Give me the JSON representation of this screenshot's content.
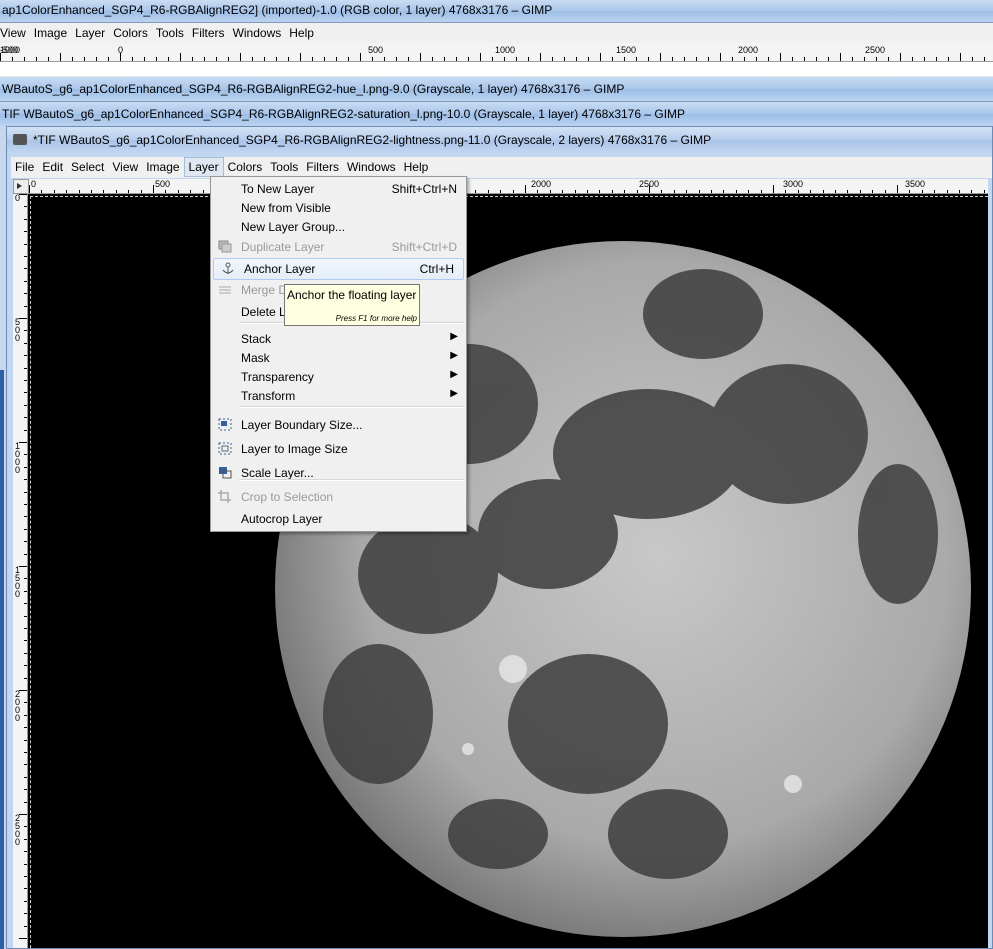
{
  "background_window": {
    "title": "ap1ColorEnhanced_SGP4_R6-RGBAlignREG2] (imported)-1.0 (RGB color, 1 layer) 4768x3176 – GIMP",
    "menu": [
      "View",
      "Image",
      "Layer",
      "Colors",
      "Tools",
      "Filters",
      "Windows",
      "Help"
    ],
    "ruler_ticks": [
      "1000",
      "-500",
      "0",
      "500",
      "1000",
      "1500",
      "2000",
      "2500"
    ]
  },
  "window_hue": {
    "title": "WBautoS_g6_ap1ColorEnhanced_SGP4_R6-RGBAlignREG2-hue_l.png-9.0 (Grayscale, 1 layer) 4768x3176 – GIMP"
  },
  "window_saturation": {
    "title": "TIF WBautoS_g6_ap1ColorEnhanced_SGP4_R6-RGBAlignREG2-saturation_l.png-10.0 (Grayscale, 1 layer) 4768x3176 – GIMP"
  },
  "active_window": {
    "title": "*TIF WBautoS_g6_ap1ColorEnhanced_SGP4_R6-RGBAlignREG2-lightness.png-11.0 (Grayscale, 2 layers) 4768x3176 – GIMP",
    "menu": [
      "File",
      "Edit",
      "Select",
      "View",
      "Image",
      "Layer",
      "Colors",
      "Tools",
      "Filters",
      "Windows",
      "Help"
    ],
    "ruler_ticks": [
      "0",
      "500",
      "2000",
      "2500",
      "3000",
      "3500"
    ],
    "vruler_ticks": [
      "0",
      "5\n0\n0",
      "1\n0\n0\n0",
      "1\n5\n0\n0",
      "2\n0\n0\n0",
      "2\n5\n0\n0"
    ]
  },
  "layer_menu": {
    "items": [
      {
        "label": "To New Layer",
        "shortcut": "Shift+Ctrl+N",
        "disabled": false,
        "icon": ""
      },
      {
        "label": "New from Visible",
        "shortcut": "",
        "disabled": false,
        "icon": ""
      },
      {
        "label": "New Layer Group...",
        "shortcut": "",
        "disabled": false,
        "icon": ""
      },
      {
        "label": "Duplicate Layer",
        "shortcut": "Shift+Ctrl+D",
        "disabled": true,
        "icon": "duplicate-layer-icon"
      },
      {
        "label": "Anchor Layer",
        "shortcut": "Ctrl+H",
        "disabled": false,
        "icon": "anchor-icon",
        "highlighted": true
      },
      {
        "label": "Merge D",
        "shortcut": "",
        "disabled": true,
        "icon": "merge-down-icon"
      },
      {
        "label": "Delete L",
        "shortcut": "",
        "disabled": false,
        "icon": ""
      },
      {
        "label": "Stack",
        "submenu": true,
        "disabled": false,
        "icon": ""
      },
      {
        "label": "Mask",
        "submenu": true,
        "disabled": false,
        "icon": ""
      },
      {
        "label": "Transparency",
        "submenu": true,
        "disabled": false,
        "icon": ""
      },
      {
        "label": "Transform",
        "submenu": true,
        "disabled": false,
        "icon": ""
      },
      {
        "label": "Layer Boundary Size...",
        "shortcut": "",
        "disabled": false,
        "icon": "layer-boundary-size-icon"
      },
      {
        "label": "Layer to Image Size",
        "shortcut": "",
        "disabled": false,
        "icon": "layer-to-image-size-icon"
      },
      {
        "label": "Scale Layer...",
        "shortcut": "",
        "disabled": false,
        "icon": "scale-layer-icon"
      },
      {
        "label": "Crop to Selection",
        "shortcut": "",
        "disabled": true,
        "icon": "crop-icon"
      },
      {
        "label": "Autocrop Layer",
        "shortcut": "",
        "disabled": false,
        "icon": ""
      }
    ]
  },
  "tooltip": {
    "text": "Anchor the floating layer",
    "help": "Press F1 for more help"
  },
  "colors": {
    "titlebar": "#b0cbed",
    "menu_bg": "#f0f0f0",
    "canvas": "#000000",
    "tooltip_bg": "#ffffe1",
    "highlight": "#e4edf8"
  }
}
